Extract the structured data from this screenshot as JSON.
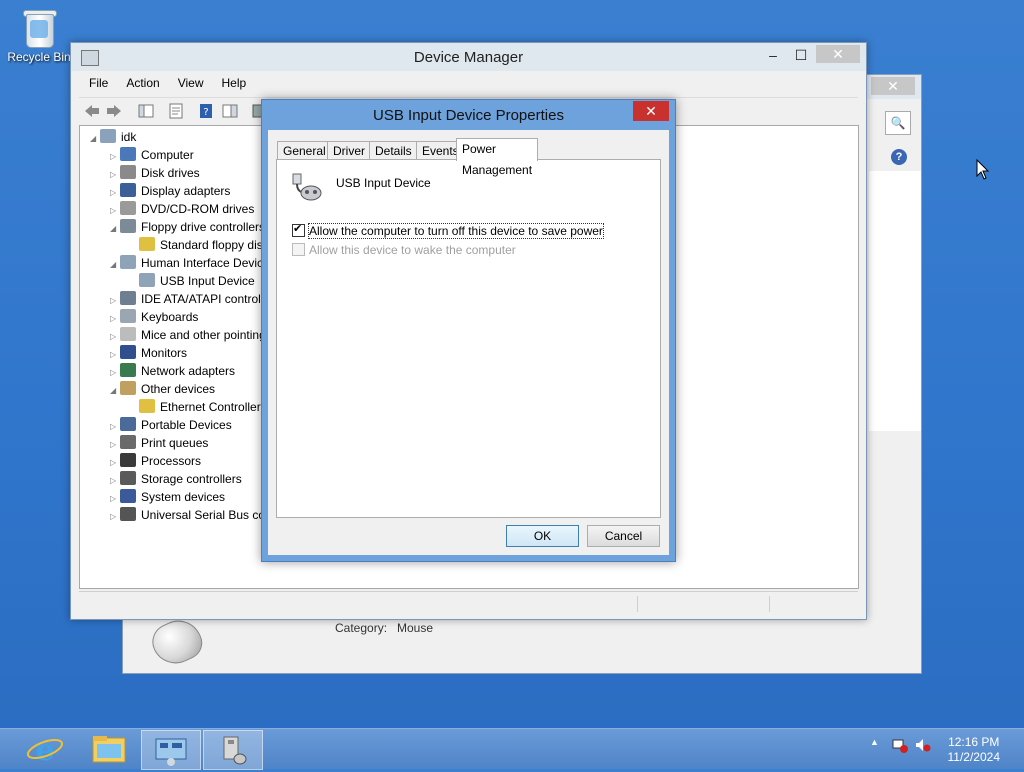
{
  "desktop": {
    "recycle_bin_label": "Recycle Bin"
  },
  "bg_window": {
    "category_label": "Category:",
    "category_value": "Mouse",
    "close_glyph": "✕",
    "search_glyph": "🔍",
    "help_glyph": "?"
  },
  "device_manager": {
    "title": "Device Manager",
    "menu": [
      "File",
      "Action",
      "View",
      "Help"
    ],
    "minimize_glyph": "–",
    "maximize_glyph": "☐",
    "close_glyph": "✕",
    "tree": [
      {
        "label": "idk",
        "arrow": "◢",
        "icon": "computer-root-icon",
        "color": "#8aa2bb"
      },
      {
        "label": "Computer",
        "arrow": "▷",
        "icon": "computer-icon",
        "color": "#4a78b8"
      },
      {
        "label": "Disk drives",
        "arrow": "▷",
        "icon": "disk-drive-icon",
        "color": "#8a8a8a"
      },
      {
        "label": "Display adapters",
        "arrow": "▷",
        "icon": "display-adapter-icon",
        "color": "#3d5f99"
      },
      {
        "label": "DVD/CD-ROM drives",
        "arrow": "▷",
        "icon": "dvd-drive-icon",
        "color": "#9a9a9a"
      },
      {
        "label": "Floppy drive controllers",
        "arrow": "◢",
        "icon": "floppy-controller-icon",
        "color": "#7d8b99"
      },
      {
        "label": "Standard floppy disk controller",
        "arrow": "",
        "icon": "floppy-warning-icon",
        "color": "#e0c040"
      },
      {
        "label": "Human Interface Devices",
        "arrow": "◢",
        "icon": "hid-icon",
        "color": "#8ea3b8"
      },
      {
        "label": "USB Input Device",
        "arrow": "",
        "icon": "usb-input-icon",
        "color": "#8ea3b8"
      },
      {
        "label": "IDE ATA/ATAPI controllers",
        "arrow": "▷",
        "icon": "ide-controller-icon",
        "color": "#6d7f90"
      },
      {
        "label": "Keyboards",
        "arrow": "▷",
        "icon": "keyboard-icon",
        "color": "#9aa7b3"
      },
      {
        "label": "Mice and other pointing devices",
        "arrow": "▷",
        "icon": "mouse-icon",
        "color": "#bcbcbc"
      },
      {
        "label": "Monitors",
        "arrow": "▷",
        "icon": "monitor-icon",
        "color": "#2f4f8f"
      },
      {
        "label": "Network adapters",
        "arrow": "▷",
        "icon": "network-adapter-icon",
        "color": "#3a7a4f"
      },
      {
        "label": "Other devices",
        "arrow": "◢",
        "icon": "other-devices-icon",
        "color": "#c0a060"
      },
      {
        "label": "Ethernet Controller",
        "arrow": "",
        "icon": "ethernet-warning-icon",
        "color": "#e0c040"
      },
      {
        "label": "Portable Devices",
        "arrow": "▷",
        "icon": "portable-devices-icon",
        "color": "#4a6a9a"
      },
      {
        "label": "Print queues",
        "arrow": "▷",
        "icon": "printer-icon",
        "color": "#6a6a6a"
      },
      {
        "label": "Processors",
        "arrow": "▷",
        "icon": "processor-icon",
        "color": "#3a3a3a"
      },
      {
        "label": "Storage controllers",
        "arrow": "▷",
        "icon": "storage-controller-icon",
        "color": "#5a5a5a"
      },
      {
        "label": "System devices",
        "arrow": "▷",
        "icon": "system-devices-icon",
        "color": "#3a5a9a"
      },
      {
        "label": "Universal Serial Bus controllers",
        "arrow": "▷",
        "icon": "usb-controller-icon",
        "color": "#555555"
      }
    ]
  },
  "dialog": {
    "title": "USB Input Device Properties",
    "close_glyph": "✕",
    "tabs": [
      "General",
      "Driver",
      "Details",
      "Events",
      "Power Management"
    ],
    "device_name": "USB Input Device",
    "option_turn_off": "Allow the computer to turn off this device to save power",
    "option_wake": "Allow this device to wake the computer",
    "ok_label": "OK",
    "cancel_label": "Cancel"
  },
  "taskbar": {
    "time": "12:16 PM",
    "date": "11/2/2024",
    "show_hidden_glyph": "▲",
    "network_glyph": "✕",
    "volume_glyph": "🔇"
  },
  "colors": {
    "accent_close": "#c8312d",
    "dialog_frame": "#6ea2dd",
    "taskbar": "#5b8fd0"
  }
}
